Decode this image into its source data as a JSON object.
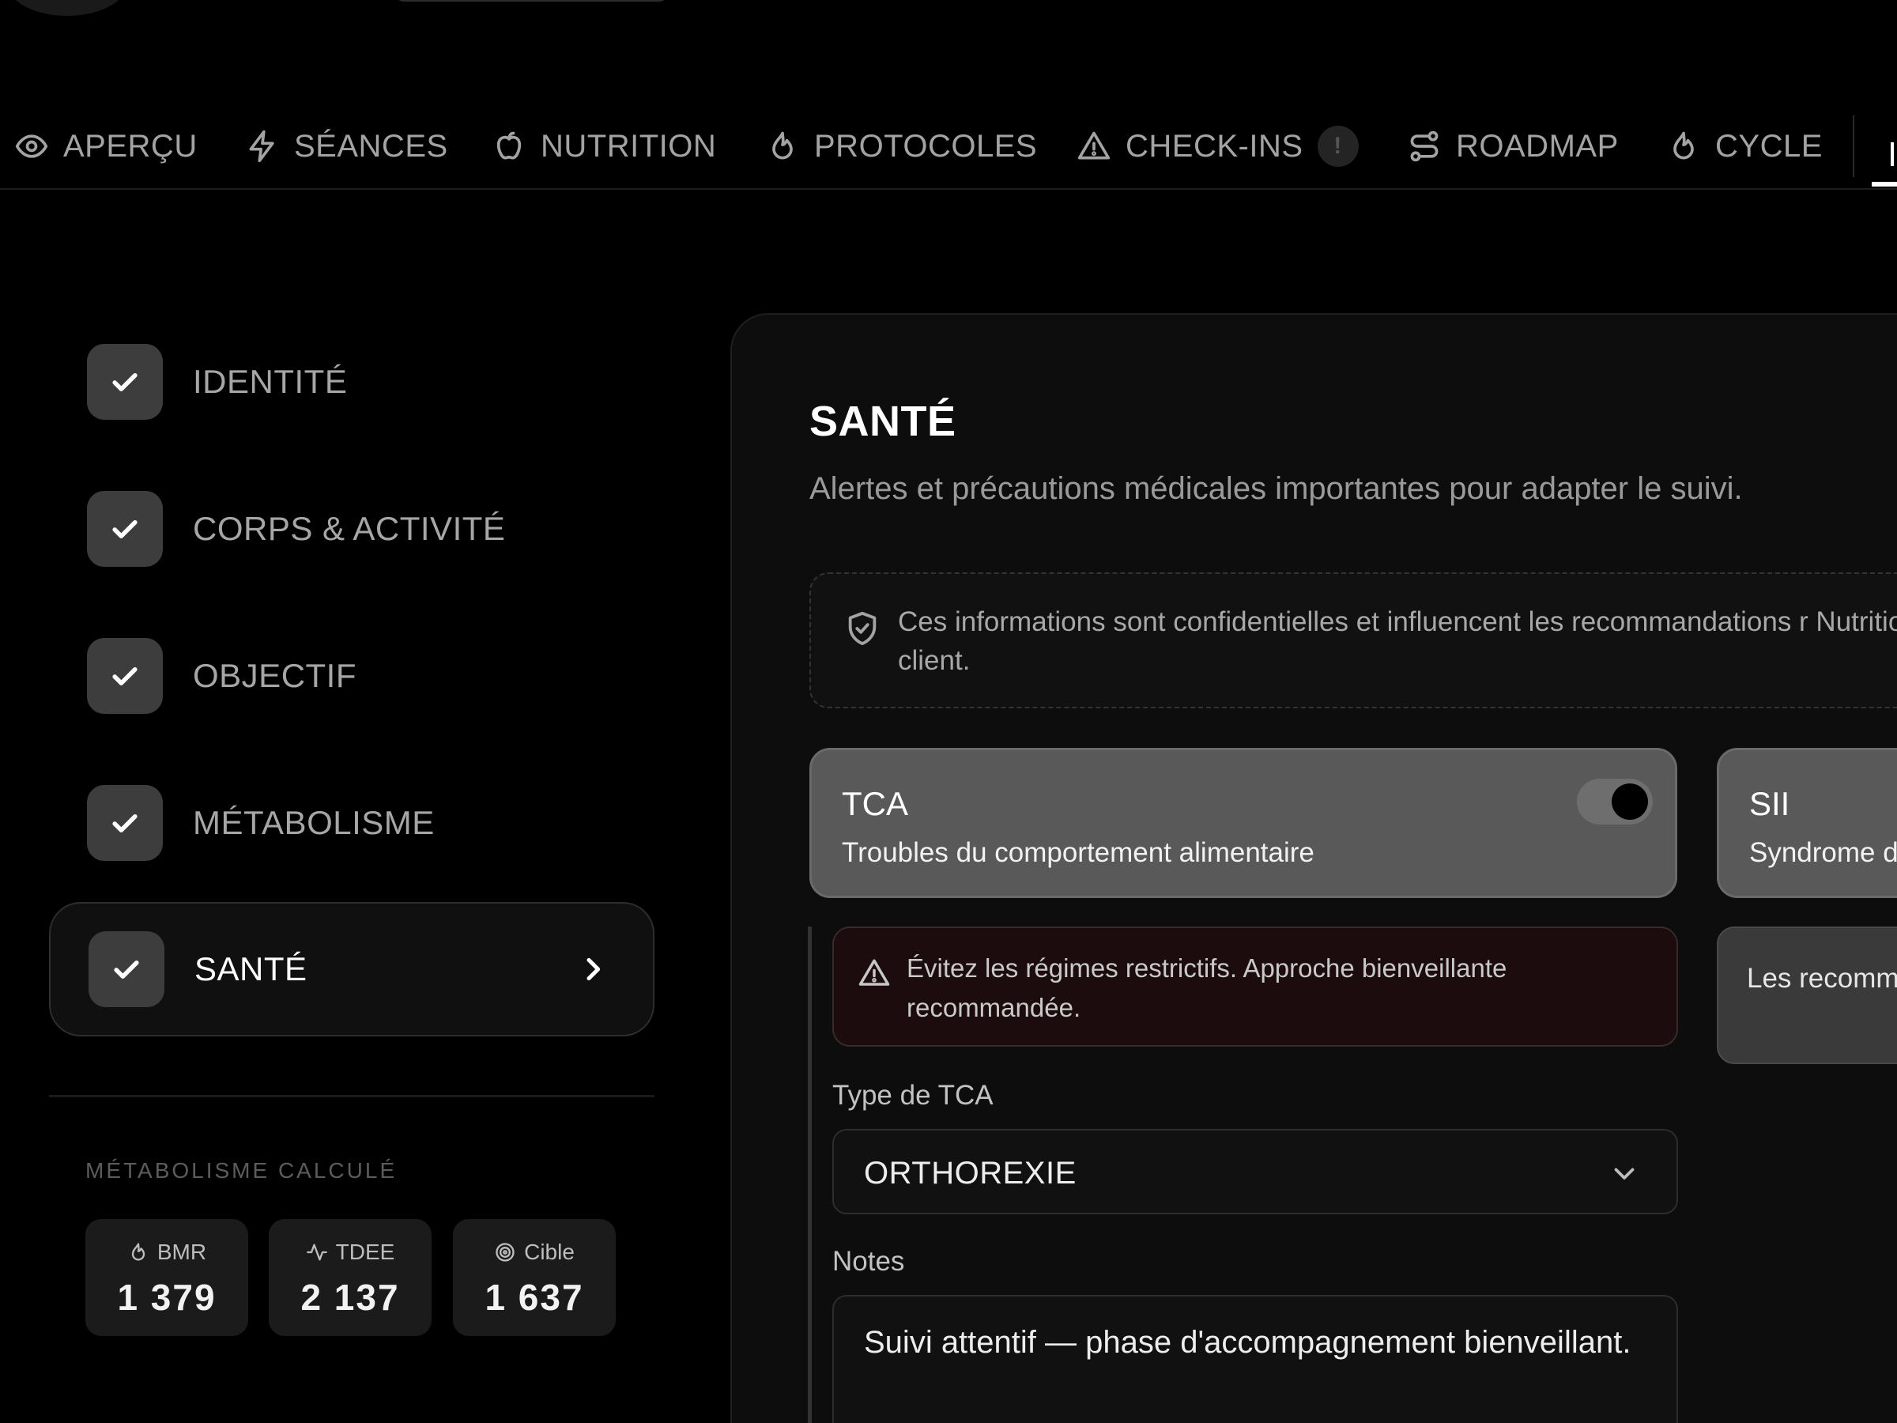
{
  "nav": {
    "tabs": [
      {
        "label": "APERÇU",
        "icon": "eye-icon"
      },
      {
        "label": "SÉANCES",
        "icon": "bolt-icon"
      },
      {
        "label": "NUTRITION",
        "icon": "apple-icon"
      },
      {
        "label": "PROTOCOLES",
        "icon": "droplet-flame-icon"
      },
      {
        "label": "CHECK-INS",
        "icon": "alert-triangle-icon",
        "badge": "!"
      },
      {
        "label": "ROADMAP",
        "icon": "route-icon"
      },
      {
        "label": "CYCLE",
        "icon": "droplet-flame-icon"
      }
    ]
  },
  "steps": [
    {
      "label": "IDENTITÉ"
    },
    {
      "label": "CORPS & ACTIVITÉ"
    },
    {
      "label": "OBJECTIF"
    },
    {
      "label": "MÉTABOLISME"
    },
    {
      "label": "SANTÉ",
      "active": true
    }
  ],
  "metabolism": {
    "title": "MÉTABOLISME CALCULÉ",
    "bmr": {
      "label": "BMR",
      "value": "1 379"
    },
    "tdee": {
      "label": "TDEE",
      "value": "2 137"
    },
    "target": {
      "label": "Cible",
      "value": "1 637"
    }
  },
  "main": {
    "title": "SANTÉ",
    "subtitle": "Alertes et précautions médicales importantes pour adapter le suivi.",
    "info": "Ces informations sont confidentielles et influencent les recommandations r Nutrition du client.",
    "conditions": [
      {
        "title": "TCA",
        "subtitle": "Troubles du comportement alimentaire",
        "enabled": true
      },
      {
        "title": "SII",
        "subtitle": "Syndrome d"
      }
    ],
    "warning": "Évitez les régimes restrictifs. Approche bienveillante recommandée.",
    "side_note": "Les recomm le régime p",
    "tca_type": {
      "label": "Type de TCA",
      "value": "ORTHOREXIE"
    },
    "notes": {
      "label": "Notes",
      "value": "Suivi attentif — phase d'accompagnement bienveillant."
    }
  },
  "colors": {
    "background": "#000000",
    "active_toggle_knob": "#000000",
    "warning_bg": "#1c0c0e"
  }
}
